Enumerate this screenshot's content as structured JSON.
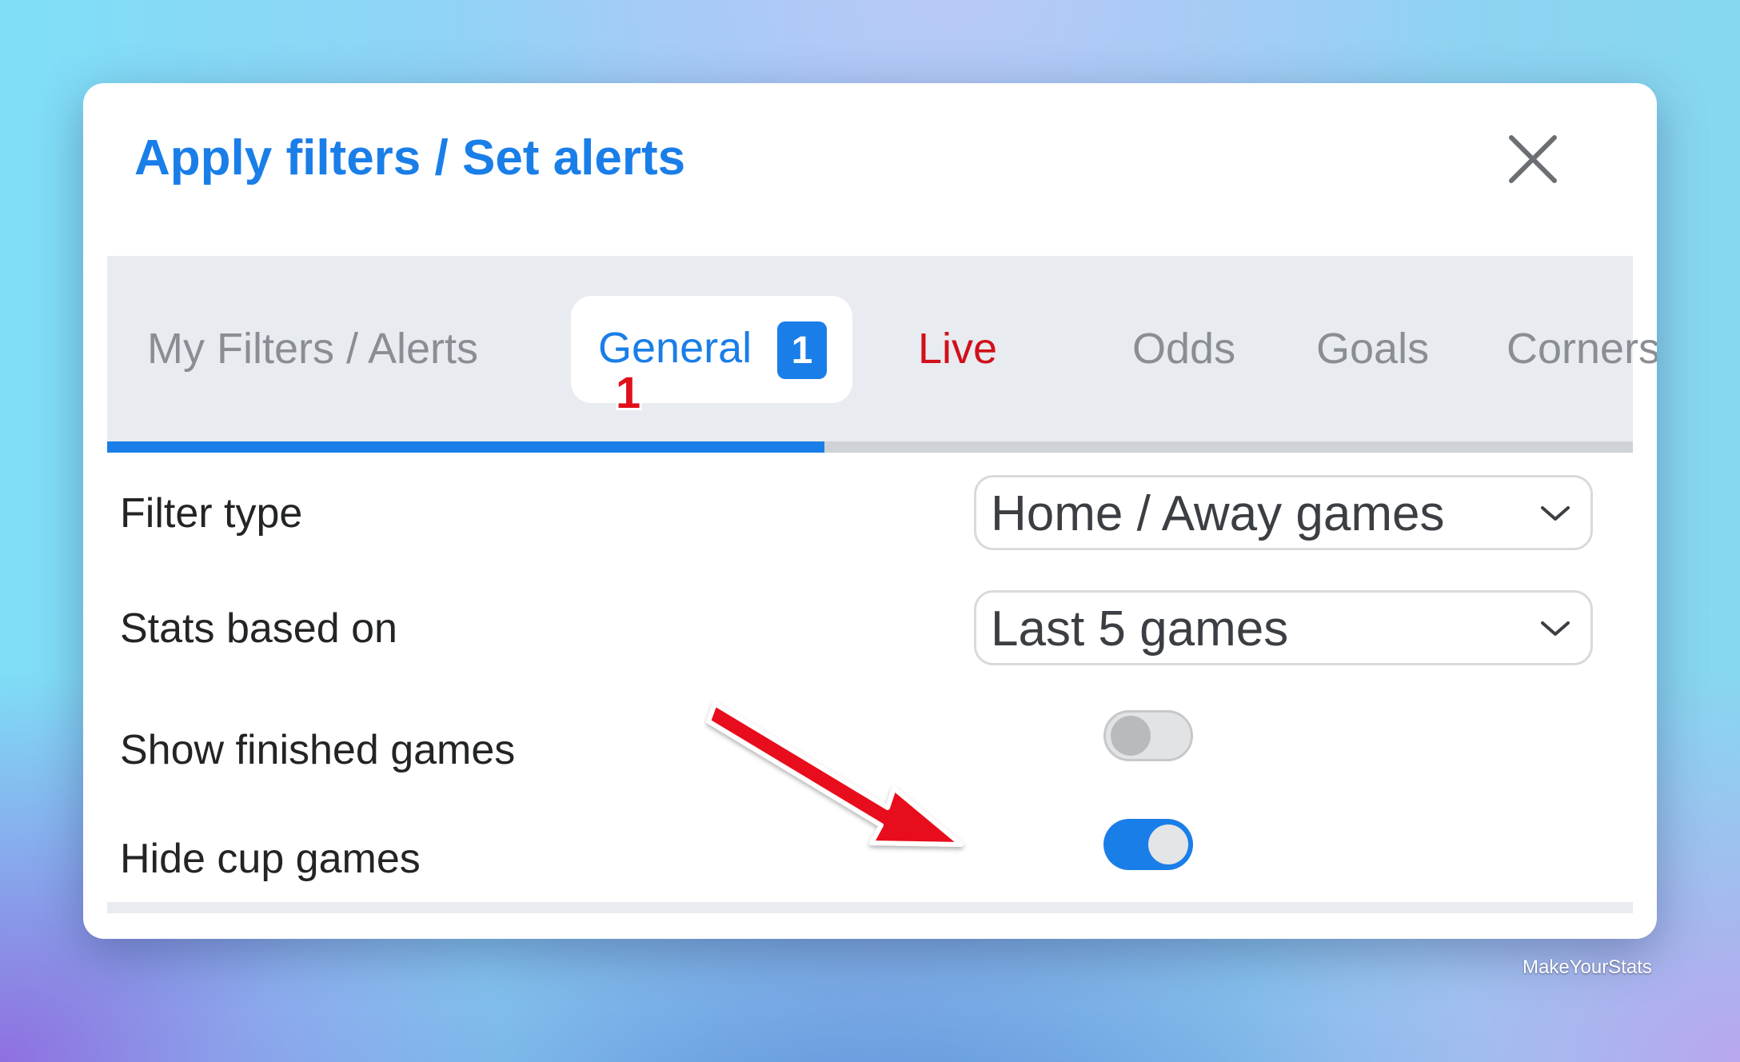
{
  "dialog": {
    "title": "Apply filters / Set alerts",
    "close_icon": "close-icon"
  },
  "tabs": {
    "items": [
      {
        "label": "My Filters / Alerts",
        "color": "#8a8e94"
      },
      {
        "label": "General",
        "badge": "1",
        "active": true,
        "color": "#1a7ee8"
      },
      {
        "label": "Live",
        "color": "#d0101a"
      },
      {
        "label": "Odds",
        "color": "#8a8e94"
      },
      {
        "label": "Goals",
        "color": "#8a8e94"
      },
      {
        "label": "Corners",
        "color": "#8a8e94"
      }
    ],
    "annotation": "1",
    "progress_percent": 47
  },
  "settings": {
    "filter_type": {
      "label": "Filter type",
      "value": "Home / Away games"
    },
    "stats_based_on": {
      "label": "Stats based on",
      "value": "Last 5 games"
    },
    "show_finished": {
      "label": "Show finished games",
      "enabled": false
    },
    "hide_cup": {
      "label": "Hide cup games",
      "enabled": true
    }
  },
  "annotation_arrow": {
    "color": "#e8101c",
    "icon": "red-arrow-icon"
  },
  "watermark": "MakeYourStats",
  "colors": {
    "accent": "#1a7ee8",
    "live": "#d0101a",
    "tab_bg": "#e8ebef"
  }
}
